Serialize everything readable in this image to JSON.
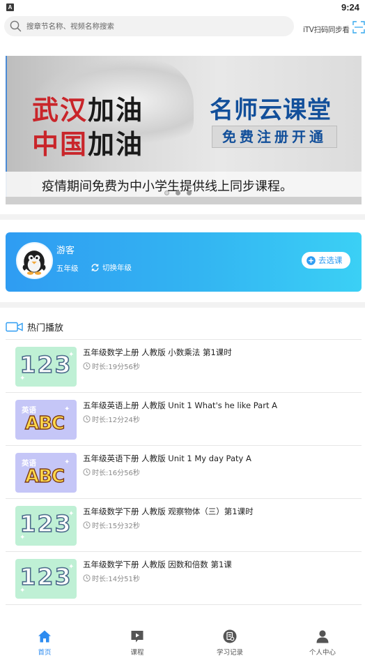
{
  "status_bar": {
    "indicator": "A",
    "time": "9:24"
  },
  "search": {
    "placeholder": "搜章节名称、视频名称搜索",
    "scan_label": "iTV扫码同步看"
  },
  "banner": {
    "line1_red": "武汉",
    "line1_dark": "加油",
    "line2_red": "中国",
    "line2_dark": "加油",
    "brand": "名师云课堂",
    "register": "免费注册开通",
    "caption": "疫情期间免费为中小学生提供线上同步课程。",
    "slides": 3,
    "active_slide": 1
  },
  "profile": {
    "name": "游客",
    "grade": "五年级",
    "switch_label": "切换年级",
    "select_course_label": "去选课"
  },
  "hot": {
    "title": "热门播放",
    "courses": [
      {
        "title": "五年级数学上册 人教版 小数乘法 第1课时",
        "duration": "时长:19分56秒",
        "thumb": "math",
        "thumb_text": "123"
      },
      {
        "title": "五年级英语上册 人教版 Unit 1 What's he like Part A",
        "duration": "时长:12分24秒",
        "thumb": "english",
        "thumb_label": "英语",
        "thumb_text": "ABC"
      },
      {
        "title": "五年级英语下册 人教版 Unit 1 My day Paty A",
        "duration": "时长:16分56秒",
        "thumb": "english",
        "thumb_label": "英语",
        "thumb_text": "ABC"
      },
      {
        "title": "五年级数学下册 人教版 观察物体（三）第1课时",
        "duration": "时长:15分32秒",
        "thumb": "math",
        "thumb_text": "123"
      },
      {
        "title": "五年级数学下册 人教版 因数和倍数 第1课",
        "duration": "时长:14分51秒",
        "thumb": "math",
        "thumb_text": "123"
      }
    ]
  },
  "nav": {
    "items": [
      {
        "label": "首页",
        "icon": "home-icon",
        "active": true
      },
      {
        "label": "课程",
        "icon": "course-icon",
        "active": false
      },
      {
        "label": "学习记录",
        "icon": "study-record-icon",
        "active": false
      },
      {
        "label": "个人中心",
        "icon": "profile-icon",
        "active": false
      }
    ]
  },
  "colors": {
    "accent": "#2e8cf0",
    "card_start": "#2f9cf2",
    "card_end": "#3bd0f5",
    "banner_red": "#c9252a",
    "banner_blue": "#124f9a"
  }
}
